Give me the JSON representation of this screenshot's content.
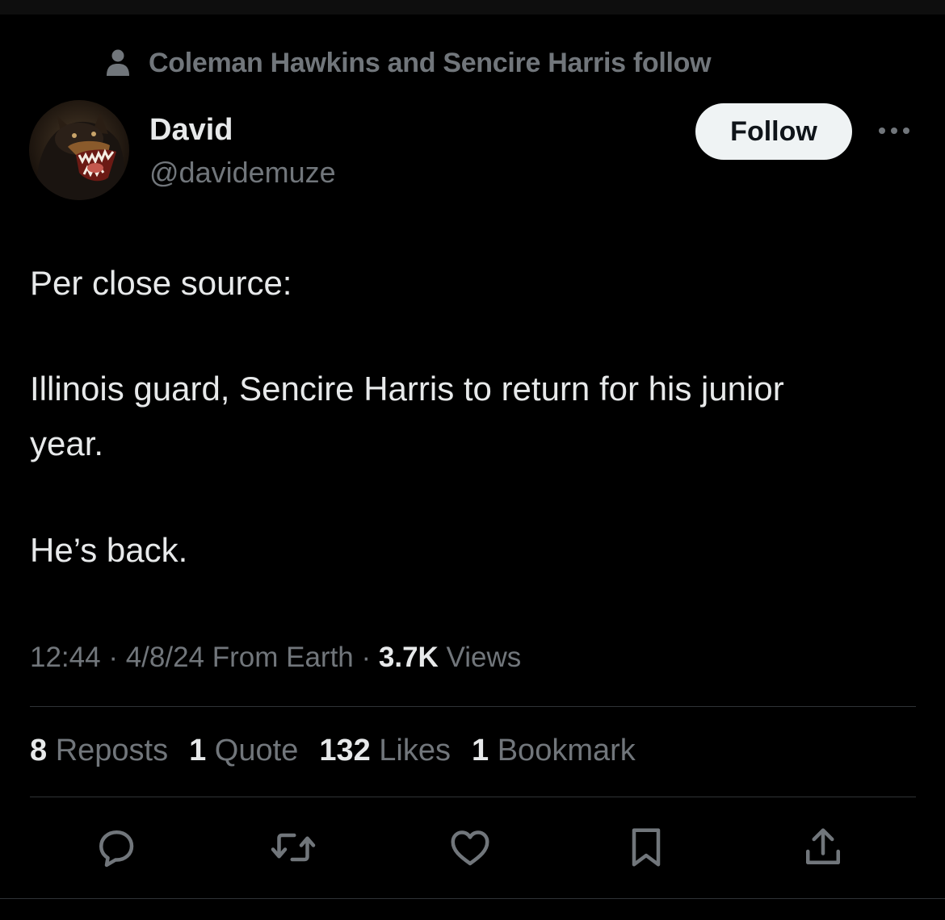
{
  "social_context": {
    "text": "Coleman Hawkins and Sencire Harris follow",
    "icon": "person-icon"
  },
  "author": {
    "name": "David",
    "handle": "@davidemuze",
    "avatar": "rottweiler-avatar"
  },
  "follow_label": "Follow",
  "more_icon": "more-icon",
  "tweet": {
    "line1": "Per close source:",
    "line2": "Illinois guard, Sencire Harris to return for his junior",
    "line3": "year.",
    "line4": "He’s back."
  },
  "meta": {
    "time": "12:44",
    "sep1": " · ",
    "date": "4/8/24",
    "source": " From Earth",
    "sep2": " · ",
    "views_count": "3.7K",
    "views_label": " Views"
  },
  "stats": {
    "reposts_count": "8",
    "reposts_label": " Reposts",
    "quote_count": "1",
    "quote_label": " Quote",
    "likes_count": "132",
    "likes_label": " Likes",
    "bookmark_count": "1",
    "bookmark_label": " Bookmark"
  },
  "actions": [
    "reply-icon",
    "repost-icon",
    "like-icon",
    "bookmark-icon",
    "share-icon"
  ],
  "colors": {
    "background": "#000000",
    "text": "#e7e9ea",
    "secondary": "#71767b",
    "divider": "#2f3336",
    "button": "#eff3f4"
  }
}
